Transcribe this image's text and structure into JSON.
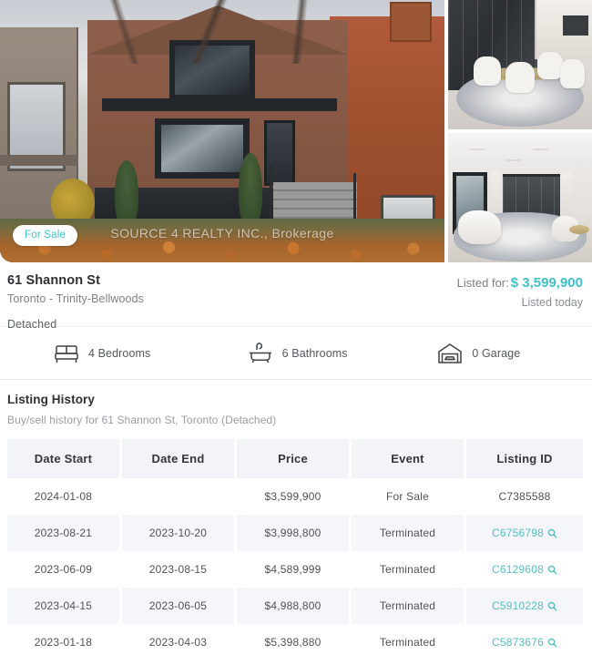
{
  "gallery": {
    "main_photo_name": "exterior-front-of-house",
    "badge_label": "For Sale",
    "watermark": "SOURCE 4 REALTY INC., Brokerage",
    "thumbnails": [
      {
        "name": "interior-dining-room"
      },
      {
        "name": "interior-living-room"
      }
    ]
  },
  "listing": {
    "address": "61 Shannon St",
    "locality": "Toronto - Trinity-Bellwoods",
    "property_type": "Detached",
    "listed_for_label": "Listed for:",
    "price": "$ 3,599,900",
    "listed_when": "Listed today",
    "price_color": "#3fc3c6"
  },
  "features": [
    {
      "icon": "bed-icon",
      "label": "4 Bedrooms"
    },
    {
      "icon": "bathtub-icon",
      "label": "6 Bathrooms"
    },
    {
      "icon": "garage-icon",
      "label": "0 Garage"
    }
  ],
  "history": {
    "title": "Listing History",
    "subtitle": "Buy/sell history for 61 Shannon St, Toronto (Detached)",
    "columns": [
      "Date Start",
      "Date End",
      "Price",
      "Event",
      "Listing ID"
    ],
    "rows": [
      {
        "date_start": "2024-01-08",
        "date_end": "",
        "price": "$3,599,900",
        "event": "For Sale",
        "listing_id": "C7385588",
        "listing_id_link": false
      },
      {
        "date_start": "2023-08-21",
        "date_end": "2023-10-20",
        "price": "$3,998,800",
        "event": "Terminated",
        "listing_id": "C6756798",
        "listing_id_link": true
      },
      {
        "date_start": "2023-06-09",
        "date_end": "2023-08-15",
        "price": "$4,589,999",
        "event": "Terminated",
        "listing_id": "C6129608",
        "listing_id_link": true
      },
      {
        "date_start": "2023-04-15",
        "date_end": "2023-06-05",
        "price": "$4,988,800",
        "event": "Terminated",
        "listing_id": "C5910228",
        "listing_id_link": true
      },
      {
        "date_start": "2023-01-18",
        "date_end": "2023-04-03",
        "price": "$5,398,880",
        "event": "Terminated",
        "listing_id": "C5873676",
        "listing_id_link": true
      }
    ],
    "link_color": "#56bfc4",
    "search_icon_name": "magnifier-icon"
  }
}
